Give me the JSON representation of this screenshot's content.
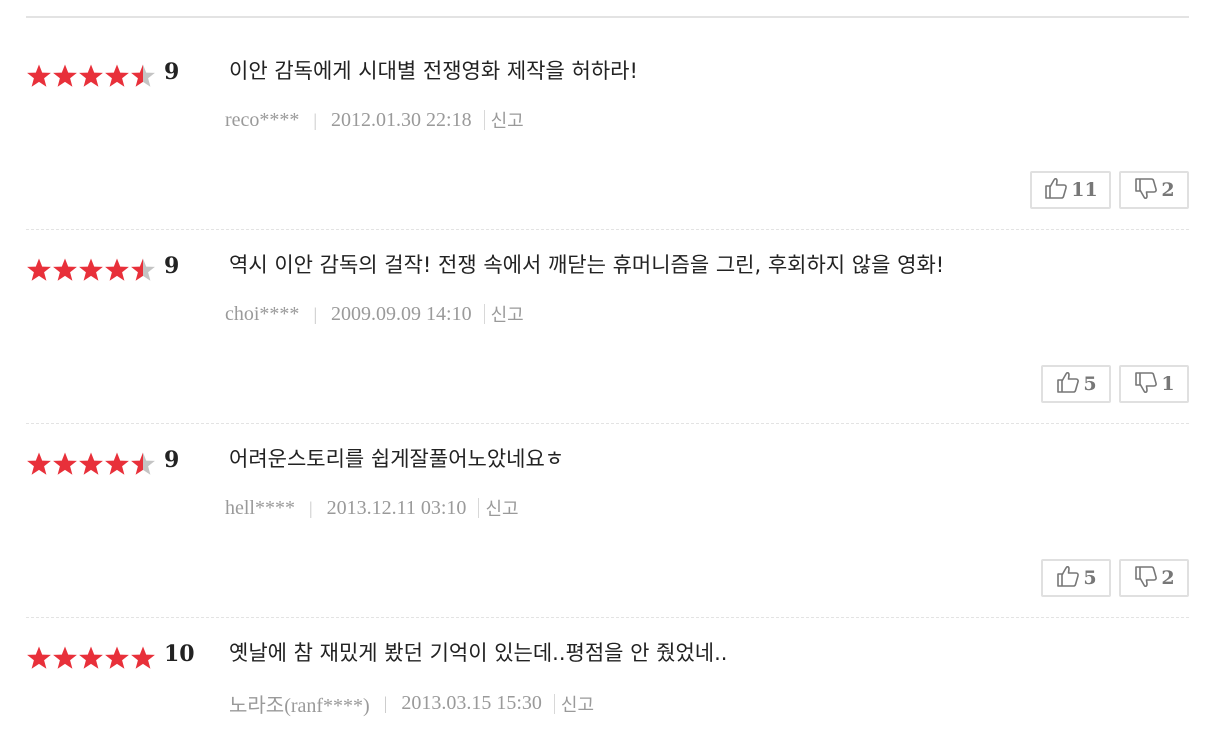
{
  "reviews": [
    {
      "stars": 4.5,
      "score": "9",
      "text": "이안 감독에게 시대별 전쟁영화 제작을 허하라!",
      "user": "reco****",
      "date": "2012.01.30 22:18",
      "report": "신고",
      "likes": "11",
      "dislikes": "2"
    },
    {
      "stars": 4.5,
      "score": "9",
      "text": "역시 이안 감독의 걸작! 전쟁 속에서 깨닫는 휴머니즘을 그린, 후회하지 않을 영화!",
      "user": "choi****",
      "date": "2009.09.09 14:10",
      "report": "신고",
      "likes": "5",
      "dislikes": "1"
    },
    {
      "stars": 4.5,
      "score": "9",
      "text": "어려운스토리를 쉽게잘풀어노았네요ㅎ",
      "user": "hell****",
      "date": "2013.12.11 03:10",
      "report": "신고",
      "likes": "5",
      "dislikes": "2"
    },
    {
      "stars": 5,
      "score": "10",
      "text": "옛날에 참 재밌게 봤던 기억이 있는데..평점을 안 줬었네..",
      "user": "노라조(ranf****)",
      "date": "2013.03.15 15:30",
      "report": "신고",
      "likes": "",
      "dislikes": ""
    }
  ],
  "colors": {
    "star_filled": "#e8303a",
    "star_empty": "#c4c4c4",
    "text": "#222222",
    "meta": "#9a9a9a"
  },
  "icons": {
    "like": "thumbs-up-icon",
    "dislike": "thumbs-down-icon",
    "star": "star-icon"
  }
}
